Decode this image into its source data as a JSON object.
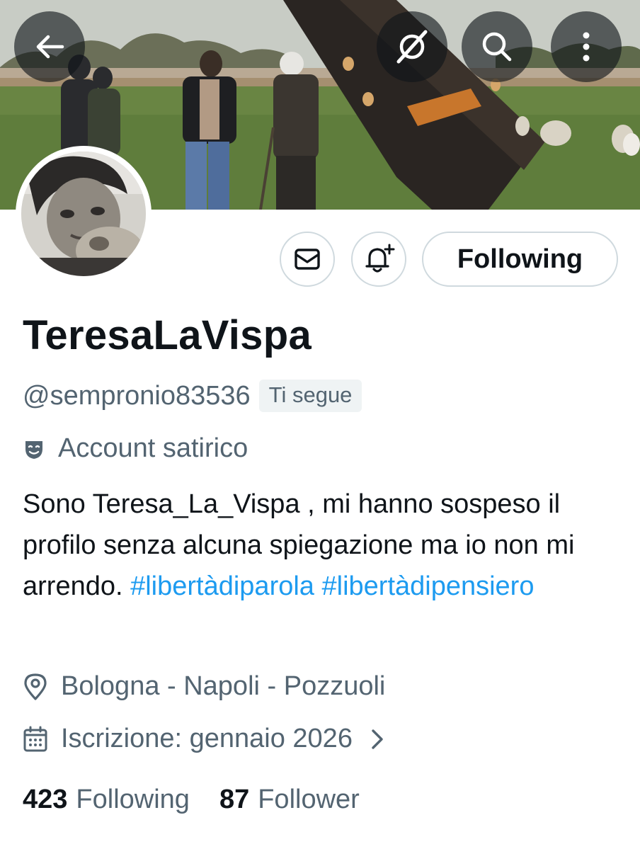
{
  "header": {
    "back_icon": "arrow-left-icon",
    "grok_icon": "grok-icon",
    "search_icon": "search-icon",
    "more_icon": "more-vertical-icon"
  },
  "profile": {
    "display_name": "TeresaLaVispa",
    "handle": "@sempronio83536",
    "follows_you": "Ti segue",
    "label": "Account satirico",
    "bio_text": "Sono Teresa_La_Vispa , mi hanno sospeso il profilo senza alcuna spiegazione ma io non mi arrendo. ",
    "hashtags": [
      "#libertàdiparola",
      "#libertàdipensiero"
    ],
    "location": "Bologna - Napoli - Pozzuoli",
    "joined": "Iscrizione: gennaio 2026"
  },
  "actions": {
    "message_icon": "envelope-icon",
    "notify_icon": "bell-plus-icon",
    "following_label": "Following"
  },
  "stats": {
    "following_count": "423",
    "following_label": "Following",
    "followers_count": "87",
    "followers_label": "Follower"
  },
  "colors": {
    "accent": "#1d9bf0",
    "secondary_text": "#536471",
    "primary_text": "#0f1419",
    "border": "#cfd9de"
  }
}
